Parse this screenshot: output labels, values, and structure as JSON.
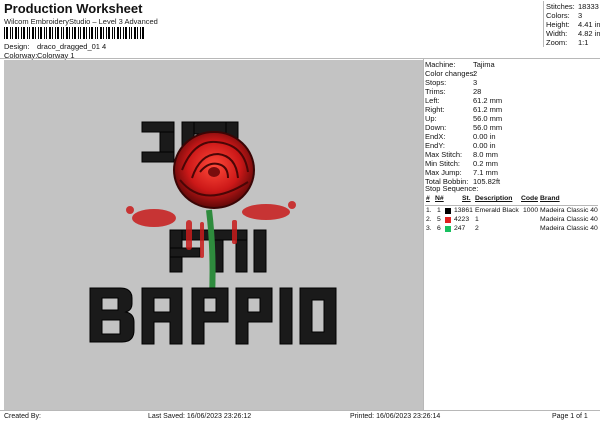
{
  "header": {
    "title": "Production Worksheet",
    "subtitle": "Wilcom EmbroideryStudio – Level 3 Advanced",
    "barcode_icon": "barcode"
  },
  "design": {
    "label": "Design:",
    "value": "draco_dragged_01 4"
  },
  "colorway": {
    "label": "Colorway:",
    "value": "Colorway 1"
  },
  "stats": [
    {
      "label": "Stitches:",
      "value": "18333"
    },
    {
      "label": "Colors:",
      "value": "3"
    },
    {
      "label": "Height:",
      "value": "4.41 in"
    },
    {
      "label": "Width:",
      "value": "4.82 in"
    },
    {
      "label": "Zoom:",
      "value": "1:1"
    }
  ],
  "properties": [
    {
      "label": "Machine:",
      "value": "Tajima"
    },
    {
      "label": "Color changes:",
      "value": "2"
    },
    {
      "label": "Stops:",
      "value": "3"
    },
    {
      "label": "Trims:",
      "value": "28"
    },
    {
      "label": "Left:",
      "value": "61.2 mm"
    },
    {
      "label": "Right:",
      "value": "61.2 mm"
    },
    {
      "label": "Up:",
      "value": "56.0 mm"
    },
    {
      "label": "Down:",
      "value": "56.0 mm"
    },
    {
      "label": "EndX:",
      "value": "0.00 in"
    },
    {
      "label": "EndY:",
      "value": "0.00 in"
    },
    {
      "label": "Max Stitch:",
      "value": "8.0 mm"
    },
    {
      "label": "Min Stitch:",
      "value": "0.2 mm"
    },
    {
      "label": "Max Jump:",
      "value": "7.1 mm"
    },
    {
      "label": "Total Bobbin:",
      "value": "105.82ft"
    }
  ],
  "sequence": {
    "title": "Stop Sequence:",
    "headers": [
      "#",
      "N#",
      "St.",
      "Description",
      "Code",
      "Brand"
    ],
    "rows": [
      {
        "num": "1.",
        "n": "1",
        "color": "#000000",
        "st": "13861",
        "desc": "Emerald Black",
        "code": "1000",
        "brand": "Madeira Classic 40"
      },
      {
        "num": "2.",
        "n": "5",
        "color": "#e02020",
        "st": "4223",
        "desc": "1",
        "code": "",
        "brand": "Madeira Classic 40"
      },
      {
        "num": "3.",
        "n": "6",
        "color": "#18c060",
        "st": "247",
        "desc": "2",
        "code": "",
        "brand": "Madeira Classic 40"
      }
    ]
  },
  "artwork": {
    "text_top": "ƆΩ",
    "text_mid": "FNI",
    "text_bottom": "BAPPIO",
    "rose_icon": "rose",
    "colors": {
      "background": "#c3c3c3",
      "letters": "#1a1a1a",
      "rose": "#d21f1f",
      "stem": "#2e8b3d"
    }
  },
  "footer": {
    "created": "Created By:",
    "saved": "Last Saved: 16/06/2023 23:26:12",
    "printed": "Printed: 16/06/2023 23:26:14",
    "page": "Page 1 of 1"
  }
}
